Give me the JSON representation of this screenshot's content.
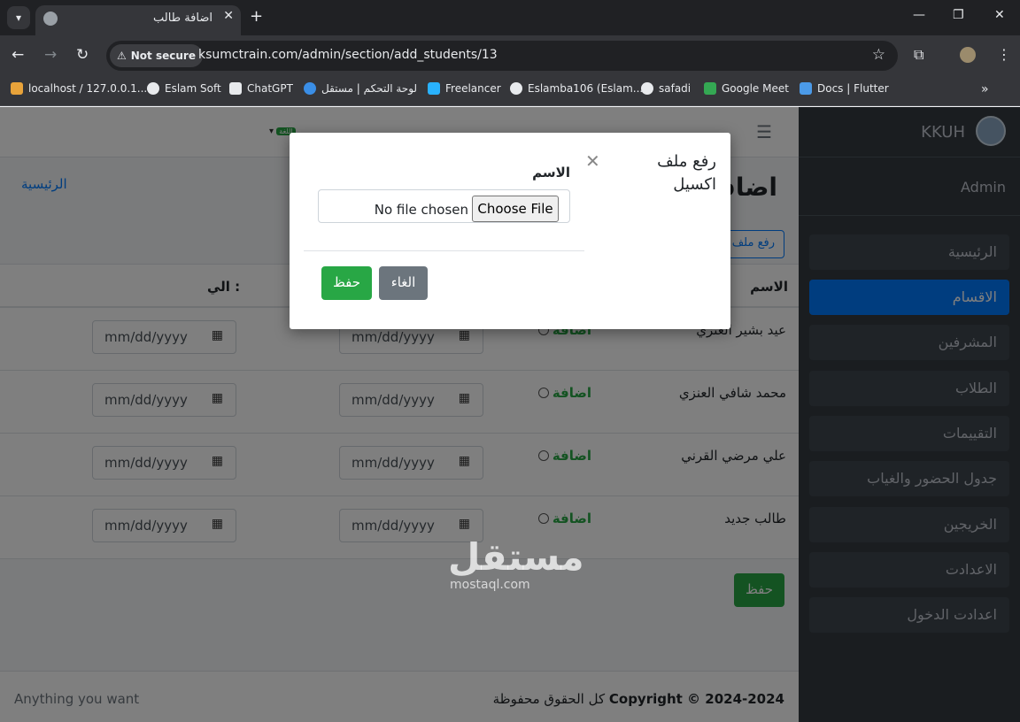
{
  "browser": {
    "tab_title": "اضافة طالب",
    "not_secure": "Not secure",
    "url": "ksumctrain.com/admin/section/add_students/13",
    "bookmarks": [
      "localhost / 127.0.0.1...",
      "Eslam Soft",
      "ChatGPT",
      "لوحة التحكم | مستقل",
      "Freelancer",
      "Eslamba106 (Eslam...",
      "safadi",
      "Google Meet",
      "Docs | Flutter"
    ]
  },
  "sidebar": {
    "brand": "KKUH",
    "user": "Admin",
    "items": [
      "الرئيسية",
      "الاقسام",
      "المشرفين",
      "الطلاب",
      "التقييمات",
      "جدول الحضور والغياب",
      "الخريجين",
      "الاعدادت",
      "اعدادت الدخول"
    ]
  },
  "topnav": {
    "lang_badge": "اللغة"
  },
  "header": {
    "breadcrumb": "الرئيسية",
    "title": "اضافة",
    "upload_button": "رفع ملف"
  },
  "table": {
    "headers": {
      "name": "الاسم",
      "to": "الي :"
    },
    "add_label": "اضافة",
    "date_placeholder": "mm/dd/yyyy",
    "rows": [
      {
        "name": "عيد بشير العنزي"
      },
      {
        "name": "محمد شافي العنزي"
      },
      {
        "name": "علي مرضي القرني"
      },
      {
        "name": "طالب جديد"
      }
    ]
  },
  "save_button": "حفظ",
  "footer": {
    "left": "Anything you want",
    "copyright": "Copyright © 2024-2024",
    "rights": "كل الحقوق محفوظة"
  },
  "watermark": {
    "main": "مستقل",
    "sub": "mostaql.com"
  },
  "modal": {
    "title": "رفع ملف اكسيل",
    "label": "الاسم",
    "file_status": "No file chosen",
    "choose_file": "Choose File",
    "save": "حفظ",
    "cancel": "الغاء"
  }
}
